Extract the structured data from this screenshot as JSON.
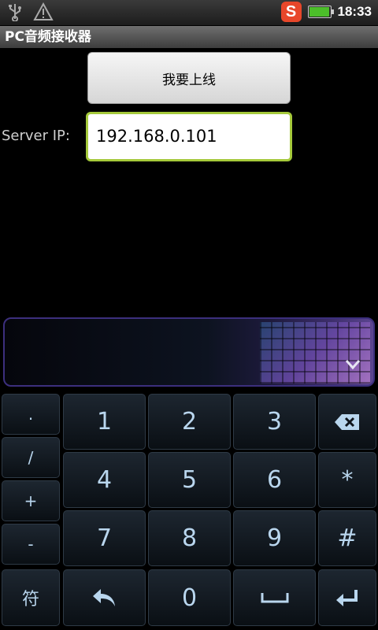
{
  "status_bar": {
    "icons": [
      "usb-icon",
      "warning-icon",
      "sogou-icon",
      "battery-icon"
    ],
    "sogou_letter": "S",
    "battery_level": 0.9,
    "time": "18:33"
  },
  "app": {
    "title": "PC音频接收器"
  },
  "main": {
    "online_button_label": "我要上线",
    "server_ip_label": "Server IP:",
    "server_ip_value": "192.168.0.101"
  },
  "keyboard": {
    "left_column": [
      ".",
      "/",
      "+",
      "-",
      "符"
    ],
    "digits": [
      "1",
      "2",
      "3",
      "4",
      "5",
      "6",
      "7",
      "8",
      "9",
      "0"
    ],
    "star": "*",
    "hash": "#",
    "icons": [
      "backspace-icon",
      "undo-icon",
      "space-icon",
      "enter-icon",
      "collapse-chevron-icon"
    ]
  },
  "colors": {
    "input_border": "#a5c93b",
    "key_text": "#b9d6ee",
    "sogou_bg": "#e8472a",
    "battery": "#4cbe2a"
  }
}
